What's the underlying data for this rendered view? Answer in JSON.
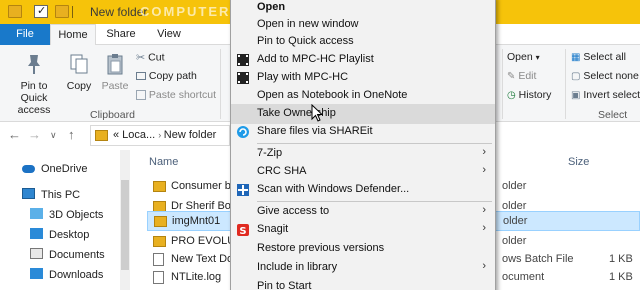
{
  "window": {
    "title": "New folder",
    "watermark": "COMPUTERWD.COM",
    "colors": {
      "titlebar": "#f6c30a",
      "file_tab": "#1979ca",
      "selection": "#cce8ff"
    }
  },
  "tabs": {
    "file": "File",
    "home": "Home",
    "share": "Share",
    "view": "View"
  },
  "ribbon": {
    "pin_label": "Pin to Quick access",
    "copy_label": "Copy",
    "paste_label": "Paste",
    "cut_label": "Cut",
    "copy_path_label": "Copy path",
    "paste_shortcut_label": "Paste shortcut",
    "clipboard_group": "Clipboard",
    "open_label": "Open",
    "edit_label": "Edit",
    "history_label": "History",
    "select_all_label": "Select all",
    "select_none_label": "Select none",
    "invert_selection_label": "Invert selectio",
    "select_group": "Select"
  },
  "address": {
    "prefix": "«  Loca...",
    "current": "New folder"
  },
  "nav": {
    "items": [
      {
        "label": "OneDrive",
        "icon": "cloud-icon"
      },
      {
        "label": "This PC",
        "icon": "pc-icon"
      },
      {
        "label": "3D Objects",
        "icon": "cube-icon"
      },
      {
        "label": "Desktop",
        "icon": "desktop-icon"
      },
      {
        "label": "Documents",
        "icon": "documents-icon"
      },
      {
        "label": "Downloads",
        "icon": "downloads-icon"
      }
    ]
  },
  "files": {
    "headers": {
      "name": "Name",
      "size": "Size"
    },
    "rows": [
      {
        "name": "Consumer bel",
        "type": "older",
        "size": "",
        "kind": "folder"
      },
      {
        "name": "Dr Sherif Book",
        "type": "older",
        "size": "",
        "kind": "folder"
      },
      {
        "name": "imgMnt01",
        "type": "older",
        "size": "",
        "kind": "folder"
      },
      {
        "name": "PRO EVOLUTI",
        "type": "older",
        "size": "",
        "kind": "folder"
      },
      {
        "name": "New Text Doc",
        "type": "ows Batch File",
        "size": "1 KB",
        "kind": "file"
      },
      {
        "name": "NTLite.log",
        "type": "ocument",
        "size": "1 KB",
        "kind": "file"
      }
    ]
  },
  "context_menu": {
    "items": [
      {
        "label": "Open"
      },
      {
        "label": "Open in new window"
      },
      {
        "label": "Pin to Quick access"
      },
      {
        "label": "Add to MPC-HC Playlist",
        "icon": "mpc-icon"
      },
      {
        "label": "Play with MPC-HC",
        "icon": "mpc-icon"
      },
      {
        "label": "Open as Notebook in OneNote"
      },
      {
        "label": "Take Ownership"
      },
      {
        "label": "Share files via SHAREit",
        "icon": "shareit-icon"
      },
      {
        "label": "7-Zip",
        "submenu": true
      },
      {
        "label": "CRC SHA",
        "submenu": true
      },
      {
        "label": "Scan with Windows Defender...",
        "icon": "defender-icon"
      },
      {
        "label": "Give access to",
        "submenu": true
      },
      {
        "label": "Snagit",
        "icon": "snagit-icon",
        "submenu": true
      },
      {
        "label": "Restore previous versions"
      },
      {
        "label": "Include in library",
        "submenu": true
      },
      {
        "label": "Pin to Start"
      }
    ],
    "hovered": "Take Ownership"
  }
}
